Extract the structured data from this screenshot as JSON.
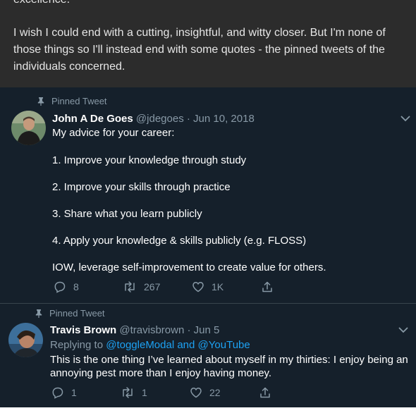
{
  "article": {
    "paragraph1": "excellence.",
    "paragraph2": "I wish I could end with a cutting, insightful, and witty closer. But I'm none of those things so I'll instead end with some quotes - the pinned tweets of the individuals concerned."
  },
  "tweets": [
    {
      "pinned_label": "Pinned Tweet",
      "name": "John A De Goes",
      "handle": "@jdegoes",
      "sep": "·",
      "date": "Jun 10, 2018",
      "lines": [
        "My advice for your career:",
        "1. Improve your knowledge through study",
        "2. Improve your skills through practice",
        "3. Share what you learn publicly",
        "4. Apply your knowledge & skills publicly (e.g. FLOSS)",
        "IOW, leverage self-improvement to create value for others."
      ],
      "replies": "8",
      "retweets": "267",
      "likes": "1K"
    },
    {
      "pinned_label": "Pinned Tweet",
      "name": "Travis Brown",
      "handle": "@travisbrown",
      "sep": "·",
      "date": "Jun 5",
      "replying_prefix": "Replying to",
      "replying_to_1": "@toggleModal",
      "replying_and": "and",
      "replying_to_2": "@YouTube",
      "lines": [
        "This is the one thing I’ve learned about myself in my thirties: I enjoy being an",
        "annoying pest more than I enjoy having money."
      ],
      "replies": "1",
      "retweets": "1",
      "likes": "22"
    }
  ],
  "colors": {
    "background": "#15202b",
    "article_bg": "#2c2c2c",
    "secondary_text": "#8899a6",
    "link": "#1da1f2"
  },
  "icons": [
    "pin-icon",
    "caret-down-icon",
    "reply-icon",
    "retweet-icon",
    "like-icon",
    "share-icon"
  ]
}
